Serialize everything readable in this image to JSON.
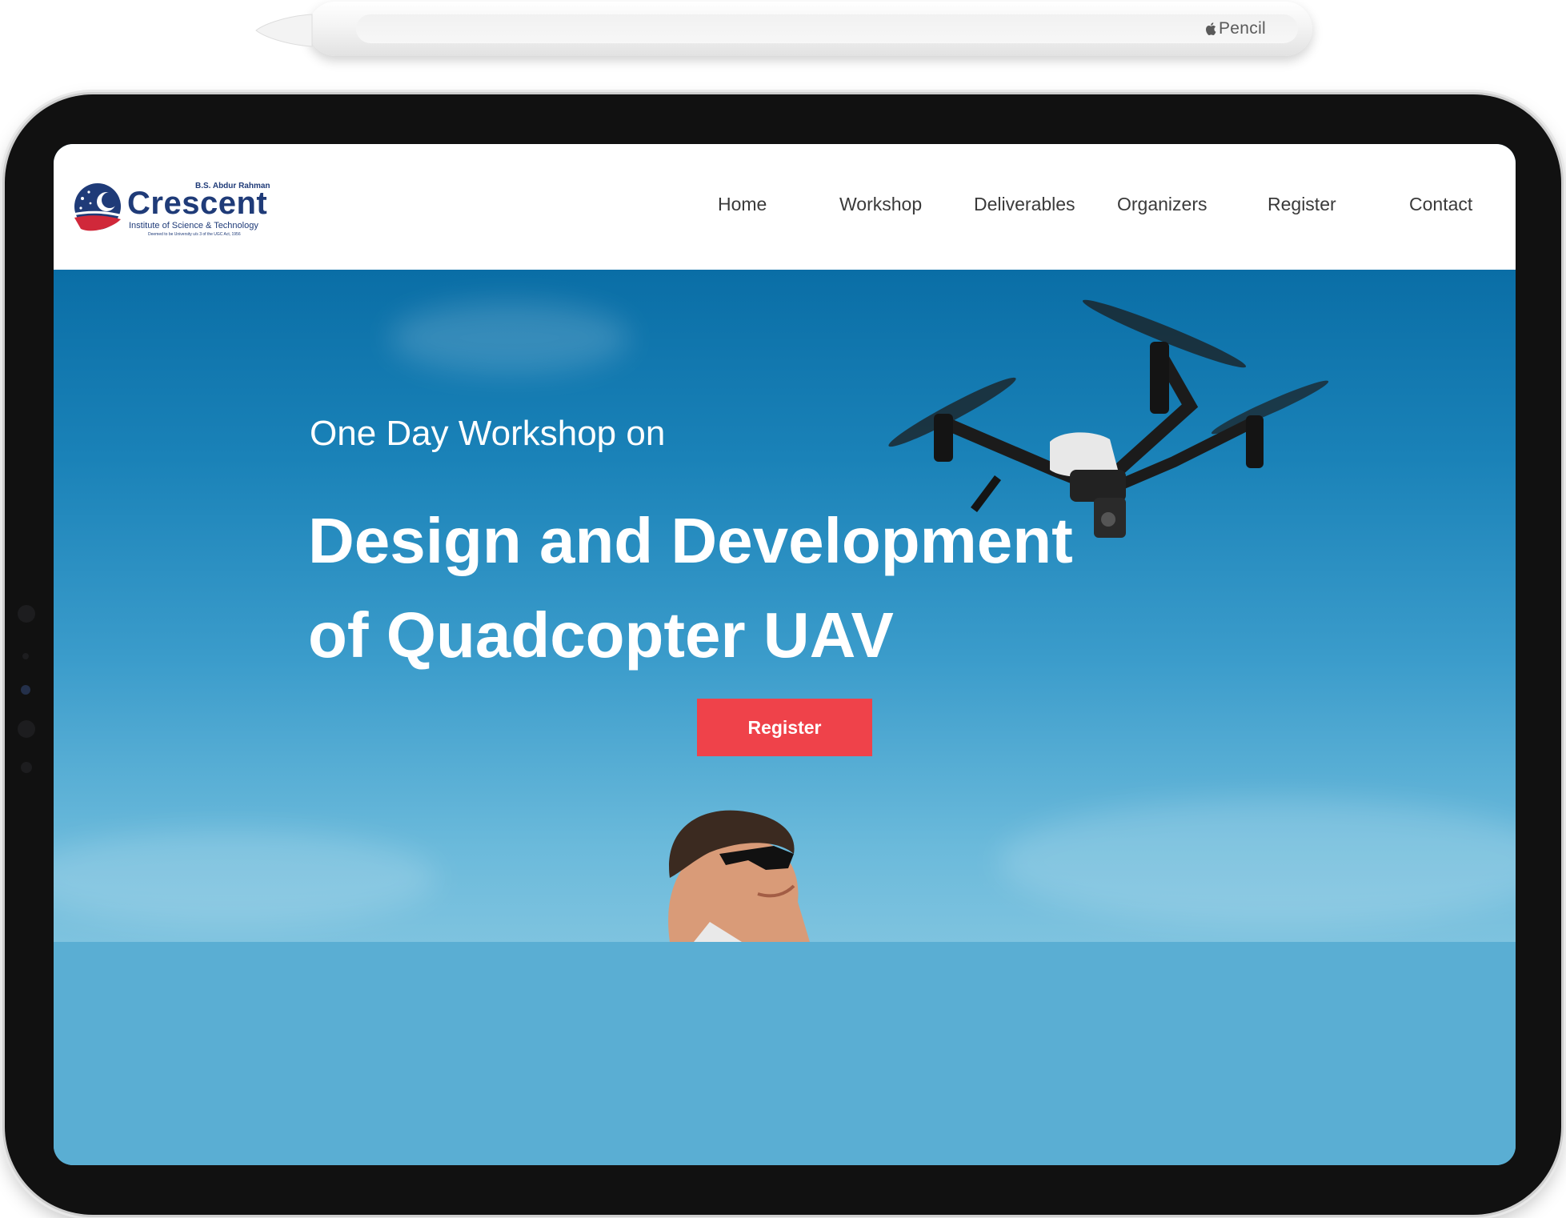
{
  "pencil": {
    "brand": "Pencil"
  },
  "site": {
    "logo": {
      "top_line": "B.S. Abdur Rahman",
      "name": "Crescent",
      "subtitle": "Institute of Science & Technology",
      "fine_print": "Deemed to be University u/s 3 of the UGC Act, 1956"
    },
    "nav": [
      {
        "label": "Home"
      },
      {
        "label": "Workshop"
      },
      {
        "label": "Deliverables"
      },
      {
        "label": "Organizers"
      },
      {
        "label": "Register"
      },
      {
        "label": "Contact"
      }
    ]
  },
  "hero": {
    "kicker": "One Day Workshop on",
    "title_line1": "Design and Development",
    "title_line2": "of Quadcopter UAV",
    "cta_label": "Register",
    "cta_color": "#ef424a"
  },
  "colors": {
    "brand_navy": "#1f3b78",
    "brand_red": "#d0283a",
    "sky_top": "#0a6ea6",
    "sky_bottom": "#7ec3df",
    "lower_band": "#5aaed3"
  },
  "icons": {
    "drone": "quadcopter-drone-icon",
    "person": "person-looking-up-icon"
  }
}
